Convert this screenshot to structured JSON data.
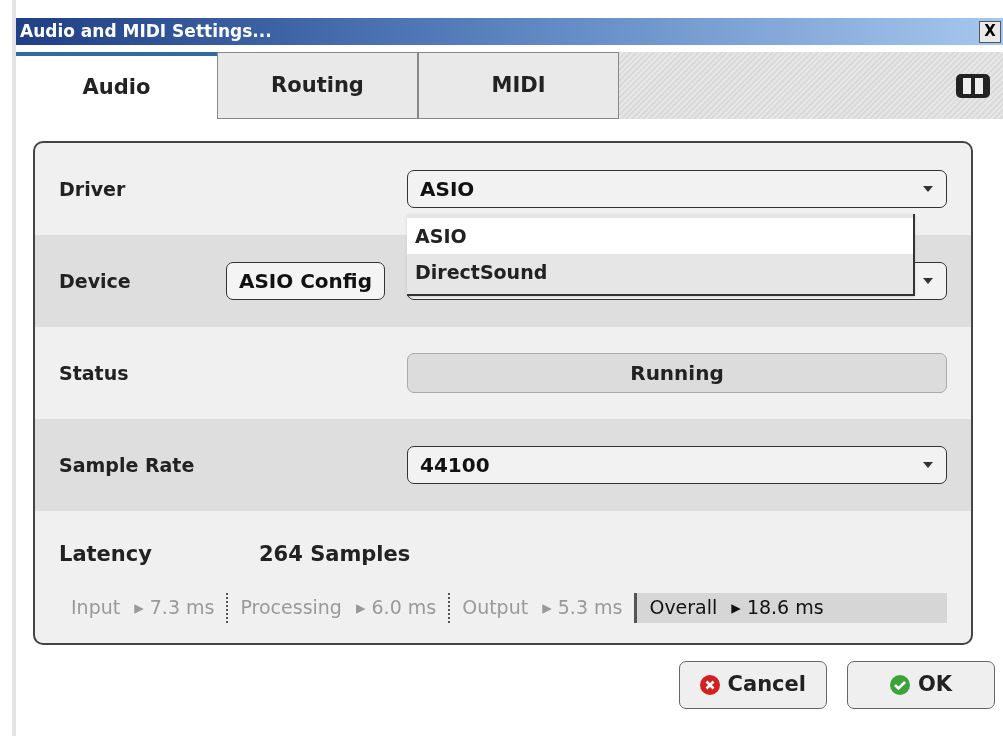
{
  "window": {
    "title": "Audio and MIDI Settings...",
    "close": "X"
  },
  "tabs": [
    {
      "label": "Audio",
      "selected": true
    },
    {
      "label": "Routing",
      "selected": false
    },
    {
      "label": "MIDI",
      "selected": false
    }
  ],
  "rows": [
    {
      "kind": "select",
      "label": "Driver",
      "value": "ASIO",
      "options": [
        {
          "label": "ASIO",
          "selected": true
        },
        {
          "label": "DirectSound",
          "selected": false
        }
      ]
    },
    {
      "kind": "device",
      "label": "Device",
      "button": "ASIO Config"
    },
    {
      "kind": "status",
      "label": "Status",
      "value": "Running"
    },
    {
      "kind": "select",
      "label": "Sample Rate",
      "value": "44100"
    }
  ],
  "latency": {
    "label": "Latency",
    "value": "264 Samples",
    "parts": [
      {
        "label": "Input",
        "value": "▸ 7.3 ms",
        "highlighted": false
      },
      {
        "label": "Processing",
        "value": "▸ 6.0 ms",
        "highlighted": false
      },
      {
        "label": "Output",
        "value": "▸ 5.3 ms",
        "highlighted": false
      },
      {
        "label": "Overall",
        "value": "▸ 18.6 ms",
        "highlighted": true
      }
    ]
  },
  "buttons": [
    {
      "kind": "cancel",
      "label": "Cancel"
    },
    {
      "kind": "ok",
      "label": "OK"
    }
  ]
}
